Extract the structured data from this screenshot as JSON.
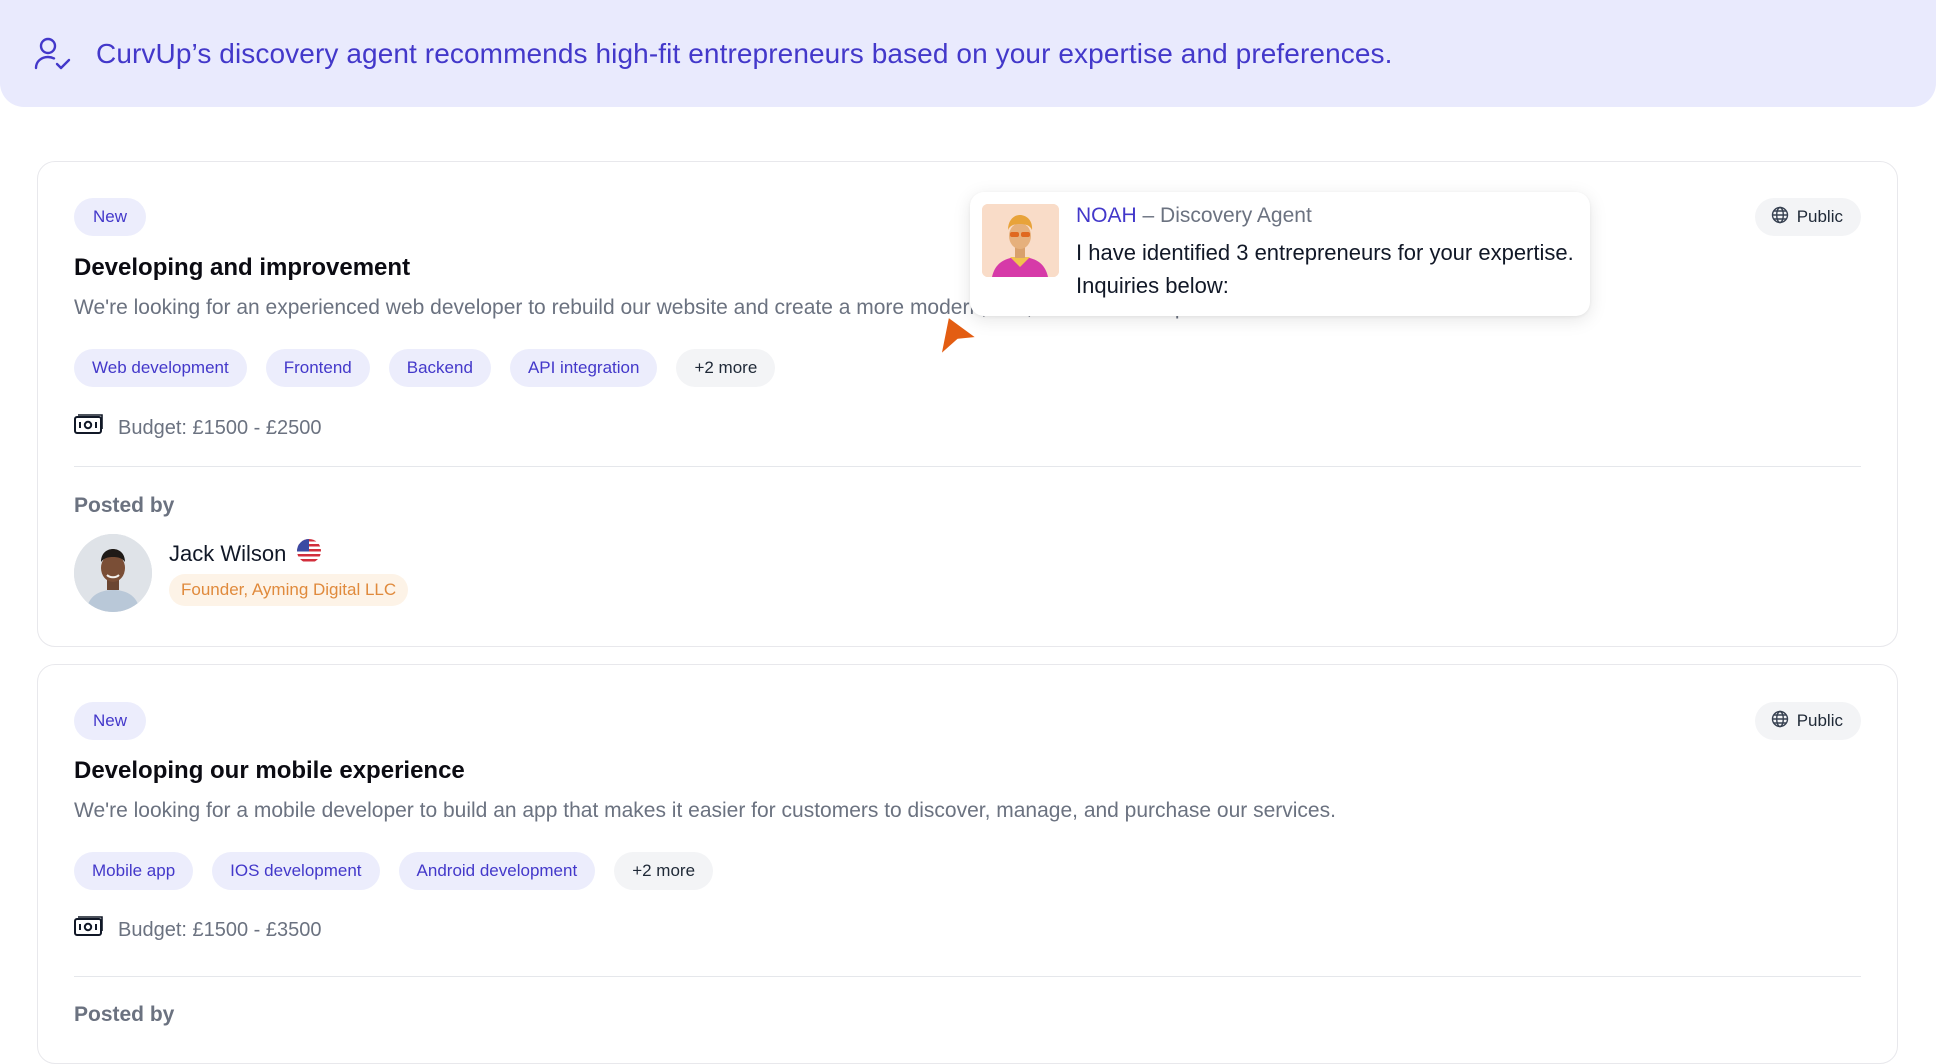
{
  "banner": {
    "text": "CurvUp’s discovery agent recommends high-fit entrepreneurs based on your expertise and preferences.",
    "icon": "user-check-icon"
  },
  "cards": [
    {
      "badge": "New",
      "visibility": "Public",
      "title": "Developing and improvement",
      "description": "We're looking for an experienced web developer to rebuild our website and create a more modern, fast, and reliable experience.",
      "tags": [
        "Web development",
        "Frontend",
        "Backend",
        "API integration"
      ],
      "more_tags": "+2 more",
      "budget": "Budget: £1500 - £2500",
      "posted_by_label": "Posted by",
      "poster": {
        "name": "Jack Wilson",
        "role": "Founder, Ayming Digital LLC",
        "flag": "us-flag-icon"
      }
    },
    {
      "badge": "New",
      "visibility": "Public",
      "title": "Developing our mobile experience",
      "description": "We're looking for a mobile developer to build an app that makes it  easier for customers to discover, manage, and purchase our services.",
      "tags": [
        "Mobile app",
        "IOS development",
        "Android development"
      ],
      "more_tags": "+2 more",
      "budget": "Budget: £1500 - £3500",
      "posted_by_label": "Posted by"
    }
  ],
  "agent_popover": {
    "name": "NOAH",
    "separator": " – ",
    "role": "Discovery Agent",
    "message": "I have identified 3 entrepreneurs for your expertise. Inquiries below:"
  },
  "colors": {
    "accent": "#4338ca",
    "banner_bg": "#e9eafd",
    "role_text": "#e08a3c",
    "cursor": "#e35d12"
  }
}
